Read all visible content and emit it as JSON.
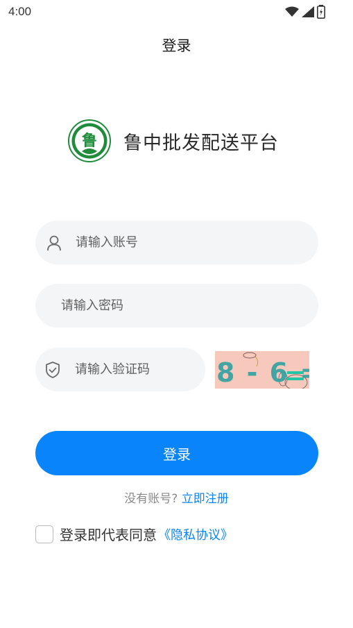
{
  "status_bar": {
    "time": "4:00",
    "icons": [
      "wifi-icon",
      "signal-icon",
      "battery-icon"
    ]
  },
  "nav": {
    "title": "登录"
  },
  "brand": {
    "logo_char": "鲁",
    "name": "鲁中批发配送平台"
  },
  "form": {
    "account": {
      "placeholder": "请输入账号",
      "value": "",
      "icon": "user-icon"
    },
    "password": {
      "placeholder": "请输入密码",
      "value": ""
    },
    "captcha": {
      "placeholder": "请输入验证码",
      "value": "",
      "icon": "shield-check-icon",
      "image_text": "8 - 6 ="
    }
  },
  "login_button": {
    "label": "登录"
  },
  "register": {
    "prompt": "没有账号?",
    "link": "立即注册"
  },
  "agreement": {
    "checked": false,
    "text": "登录即代表同意",
    "link": "《隐私协议》"
  },
  "colors": {
    "accent": "#0A84FB",
    "field_bg": "#F4F5F7",
    "logo_green": "#1E8C3A",
    "captcha_bg": "#F6C9BC"
  }
}
